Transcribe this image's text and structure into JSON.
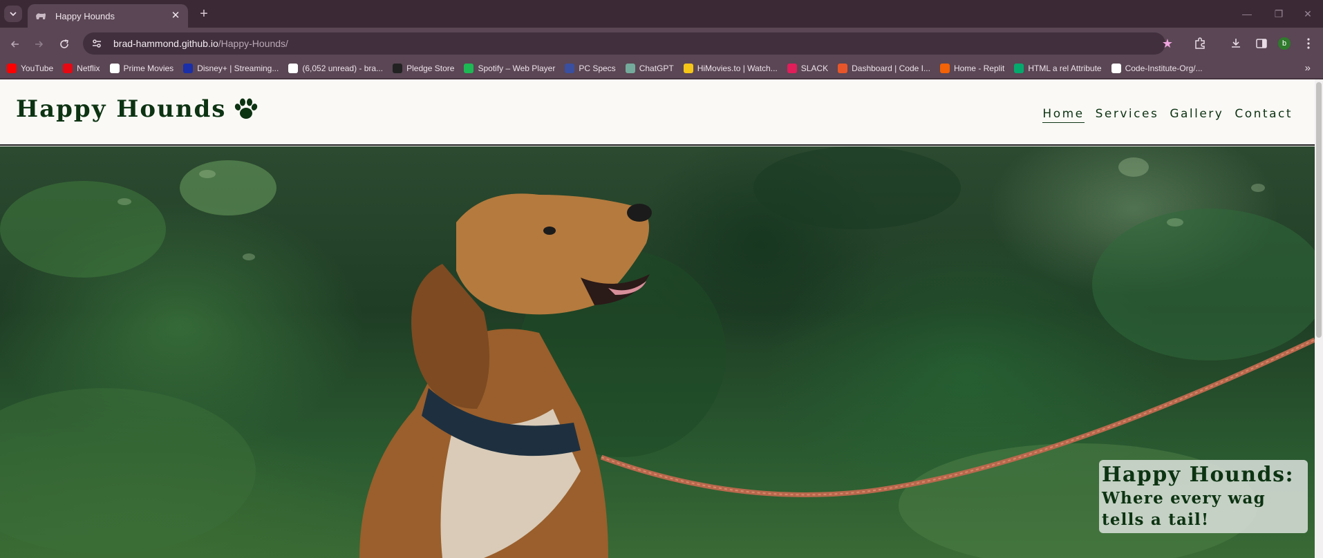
{
  "browser": {
    "tab_title": "Happy Hounds",
    "url_host": "brad-hammond.github.io",
    "url_path": "/Happy-Hounds/",
    "bookmarks": [
      {
        "label": "YouTube",
        "color": "#ff0000"
      },
      {
        "label": "Netflix",
        "color": "#e50914"
      },
      {
        "label": "Prime Movies",
        "color": "#ffffff"
      },
      {
        "label": "Disney+ | Streaming...",
        "color": "#1a2fa8"
      },
      {
        "label": "(6,052 unread) - bra...",
        "color": "#ffffff"
      },
      {
        "label": "Pledge Store",
        "color": "#222222"
      },
      {
        "label": "Spotify – Web Player",
        "color": "#1db954"
      },
      {
        "label": "PC Specs",
        "color": "#3a4fa0"
      },
      {
        "label": "ChatGPT",
        "color": "#74aa9c"
      },
      {
        "label": "HiMovies.to | Watch...",
        "color": "#f5c518"
      },
      {
        "label": "SLACK",
        "color": "#e01e5a"
      },
      {
        "label": "Dashboard | Code I...",
        "color": "#e8552a"
      },
      {
        "label": "Home - Replit",
        "color": "#f26207"
      },
      {
        "label": "HTML a rel Attribute",
        "color": "#04aa6d"
      },
      {
        "label": "Code-Institute-Org/...",
        "color": "#ffffff"
      }
    ],
    "profile_initial": "b"
  },
  "site": {
    "logo": "Happy Hounds",
    "nav": [
      "Home",
      "Services",
      "Gallery",
      "Contact"
    ],
    "active_nav": "Home",
    "tagline_title": "Happy Hounds:",
    "tagline_sub1": "Where every wag",
    "tagline_sub2": "tells a tail!",
    "brand_color": "#0c3312"
  }
}
